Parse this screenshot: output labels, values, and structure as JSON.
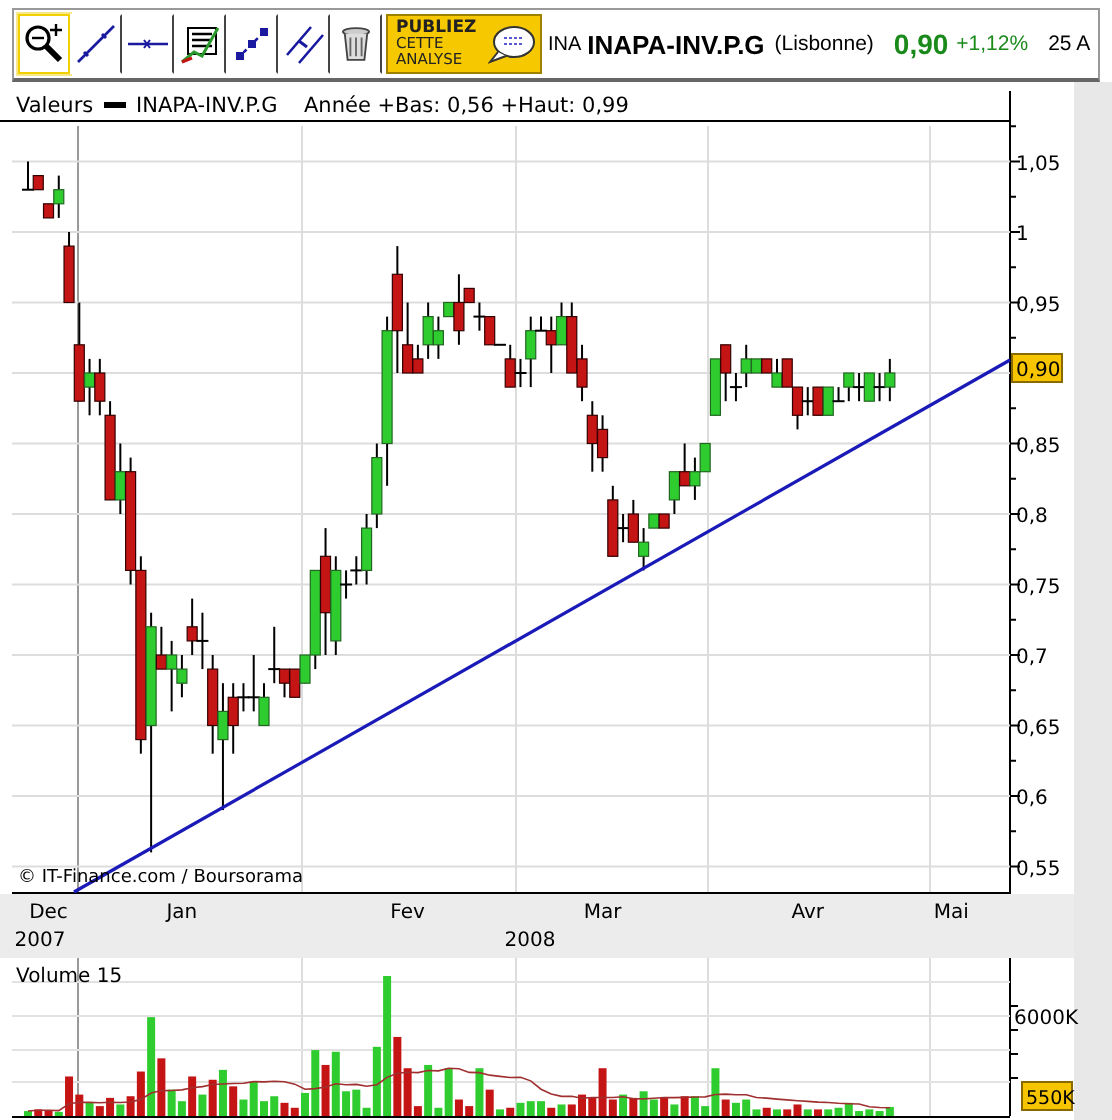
{
  "toolbar": {
    "tools": [
      {
        "kind": "zoom",
        "selected": true
      },
      {
        "kind": "trendline",
        "selected": false
      },
      {
        "kind": "horizontal",
        "selected": false
      },
      {
        "kind": "fibonacci",
        "selected": false
      },
      {
        "kind": "channel",
        "selected": false
      },
      {
        "kind": "parallel",
        "selected": false
      },
      {
        "kind": "delete",
        "selected": false
      }
    ],
    "publish_button": {
      "lines": [
        "PUBLIEZ",
        "CETTE",
        "ANALYSE"
      ]
    }
  },
  "quote": {
    "code": "INA",
    "name": "INAPA-INV.P.G",
    "market": "(Lisbonne)",
    "price": "0,90",
    "change": "+1,12%",
    "date": "25 A"
  },
  "legend": {
    "label": "Valeurs",
    "series": "INAPA-INV.P.G",
    "range": "Année +Bas: 0,56 +Haut: 0,99"
  },
  "price_chart": {
    "last_price": "0,90",
    "credit": "© IT-Finance.com / Boursorama",
    "chart_data": {
      "type": "candlestick",
      "ylim": [
        0.53,
        1.1
      ],
      "yticks": [
        {
          "value": 1.05,
          "label": "1,05"
        },
        {
          "value": 1,
          "label": "1"
        },
        {
          "value": 0.95,
          "label": "0,95"
        },
        {
          "value": 0.85,
          "label": "0,85"
        },
        {
          "value": 0.8,
          "label": "0,8"
        },
        {
          "value": 0.75,
          "label": "0,75"
        },
        {
          "value": 0.7,
          "label": "0,7"
        },
        {
          "value": 0.65,
          "label": "0,65"
        },
        {
          "value": 0.6,
          "label": "0,6"
        },
        {
          "value": 0.55,
          "label": "0,55"
        }
      ],
      "categories": [
        null,
        null,
        "Dec",
        null,
        null,
        null,
        null,
        null,
        null,
        null,
        null,
        null,
        null,
        null,
        null,
        "Jan",
        null,
        null,
        null,
        null,
        null,
        null,
        null,
        null,
        null,
        null,
        null,
        null,
        null,
        null,
        null,
        null,
        null,
        null,
        null,
        null,
        null,
        "Fev",
        null,
        null,
        null,
        null,
        null,
        null,
        null,
        null,
        null,
        null,
        null,
        null,
        null,
        null,
        null,
        null,
        null,
        null,
        "Mar",
        null,
        null,
        null,
        null,
        null,
        null,
        null,
        null,
        null,
        null,
        null,
        null,
        null,
        null,
        null,
        null,
        null,
        null,
        null,
        "Avr",
        null,
        null,
        null,
        null,
        null,
        null,
        null,
        null,
        null,
        null,
        null,
        null,
        null,
        "Mai"
      ],
      "ohlc": [
        [
          1.03,
          1.05,
          1.03,
          1.03
        ],
        [
          1.04,
          1.04,
          1.03,
          1.03
        ],
        [
          1.02,
          1.02,
          1.01,
          1.01
        ],
        [
          1.02,
          1.04,
          1.01,
          1.03
        ],
        [
          0.99,
          1.0,
          0.95,
          0.95
        ],
        [
          0.92,
          0.95,
          0.88,
          0.88
        ],
        [
          0.89,
          0.91,
          0.87,
          0.9
        ],
        [
          0.9,
          0.91,
          0.87,
          0.88
        ],
        [
          0.87,
          0.88,
          0.81,
          0.81
        ],
        [
          0.81,
          0.85,
          0.8,
          0.83
        ],
        [
          0.83,
          0.84,
          0.75,
          0.76
        ],
        [
          0.76,
          0.77,
          0.63,
          0.64
        ],
        [
          0.65,
          0.73,
          0.56,
          0.72
        ],
        [
          0.7,
          0.72,
          0.69,
          0.69
        ],
        [
          0.69,
          0.71,
          0.66,
          0.7
        ],
        [
          0.68,
          0.7,
          0.67,
          0.69
        ],
        [
          0.72,
          0.74,
          0.7,
          0.71
        ],
        [
          0.71,
          0.73,
          0.69,
          0.71
        ],
        [
          0.69,
          0.7,
          0.63,
          0.65
        ],
        [
          0.64,
          0.68,
          0.59,
          0.66
        ],
        [
          0.67,
          0.68,
          0.63,
          0.65
        ],
        [
          0.67,
          0.68,
          0.66,
          0.67
        ],
        [
          0.67,
          0.7,
          0.66,
          0.67
        ],
        [
          0.65,
          0.68,
          0.65,
          0.67
        ],
        [
          0.69,
          0.72,
          0.68,
          0.69
        ],
        [
          0.69,
          0.69,
          0.67,
          0.68
        ],
        [
          0.69,
          0.69,
          0.67,
          0.67
        ],
        [
          0.68,
          0.7,
          0.68,
          0.7
        ],
        [
          0.7,
          0.76,
          0.69,
          0.76
        ],
        [
          0.77,
          0.79,
          0.7,
          0.73
        ],
        [
          0.71,
          0.77,
          0.7,
          0.76
        ],
        [
          0.75,
          0.76,
          0.74,
          0.75
        ],
        [
          0.76,
          0.77,
          0.75,
          0.76
        ],
        [
          0.76,
          0.8,
          0.75,
          0.79
        ],
        [
          0.8,
          0.85,
          0.79,
          0.84
        ],
        [
          0.85,
          0.94,
          0.82,
          0.93
        ],
        [
          0.97,
          0.99,
          0.9,
          0.93
        ],
        [
          0.92,
          0.95,
          0.9,
          0.9
        ],
        [
          0.91,
          0.92,
          0.9,
          0.9
        ],
        [
          0.92,
          0.95,
          0.91,
          0.94
        ],
        [
          0.92,
          0.94,
          0.91,
          0.93
        ],
        [
          0.94,
          0.95,
          0.94,
          0.95
        ],
        [
          0.95,
          0.97,
          0.92,
          0.93
        ],
        [
          0.96,
          0.96,
          0.95,
          0.95
        ],
        [
          0.94,
          0.95,
          0.93,
          0.94
        ],
        [
          0.94,
          0.94,
          0.92,
          0.92
        ],
        [
          0.92,
          0.92,
          0.92,
          0.92
        ],
        [
          0.91,
          0.92,
          0.89,
          0.89
        ],
        [
          0.9,
          0.91,
          0.89,
          0.9
        ],
        [
          0.91,
          0.94,
          0.89,
          0.93
        ],
        [
          0.93,
          0.94,
          0.93,
          0.93
        ],
        [
          0.93,
          0.94,
          0.9,
          0.92
        ],
        [
          0.92,
          0.95,
          0.92,
          0.94
        ],
        [
          0.94,
          0.95,
          0.9,
          0.9
        ],
        [
          0.91,
          0.92,
          0.88,
          0.89
        ],
        [
          0.87,
          0.88,
          0.83,
          0.85
        ],
        [
          0.86,
          0.87,
          0.83,
          0.84
        ],
        [
          0.81,
          0.82,
          0.77,
          0.77
        ],
        [
          0.79,
          0.8,
          0.78,
          0.79
        ],
        [
          0.8,
          0.81,
          0.78,
          0.78
        ],
        [
          0.77,
          0.79,
          0.76,
          0.78
        ],
        [
          0.79,
          0.8,
          0.79,
          0.8
        ],
        [
          0.8,
          0.8,
          0.79,
          0.79
        ],
        [
          0.81,
          0.83,
          0.8,
          0.83
        ],
        [
          0.83,
          0.85,
          0.82,
          0.82
        ],
        [
          0.82,
          0.84,
          0.81,
          0.83
        ],
        [
          0.83,
          0.85,
          0.83,
          0.85
        ],
        [
          0.87,
          0.91,
          0.87,
          0.91
        ],
        [
          0.92,
          0.92,
          0.88,
          0.9
        ],
        [
          0.89,
          0.9,
          0.88,
          0.89
        ],
        [
          0.9,
          0.92,
          0.89,
          0.91
        ],
        [
          0.9,
          0.91,
          0.9,
          0.91
        ],
        [
          0.91,
          0.91,
          0.9,
          0.9
        ],
        [
          0.89,
          0.91,
          0.89,
          0.9
        ],
        [
          0.91,
          0.91,
          0.89,
          0.89
        ],
        [
          0.89,
          0.89,
          0.86,
          0.87
        ],
        [
          0.88,
          0.89,
          0.87,
          0.88
        ],
        [
          0.89,
          0.89,
          0.87,
          0.87
        ],
        [
          0.87,
          0.89,
          0.87,
          0.89
        ],
        [
          0.88,
          0.89,
          0.88,
          0.88
        ],
        [
          0.89,
          0.9,
          0.88,
          0.9
        ],
        [
          0.89,
          0.9,
          0.88,
          0.89
        ],
        [
          0.88,
          0.9,
          0.88,
          0.9
        ],
        [
          0.89,
          0.9,
          0.88,
          0.89
        ],
        [
          0.89,
          0.91,
          0.88,
          0.9
        ],
        null,
        null,
        null,
        null,
        null,
        null
      ]
    }
  },
  "date_axis": {
    "years": [
      "2007",
      "2008"
    ]
  },
  "volume_chart": {
    "title": "Volume 15",
    "axis_label": "6000K",
    "last_volume": "550K"
  }
}
